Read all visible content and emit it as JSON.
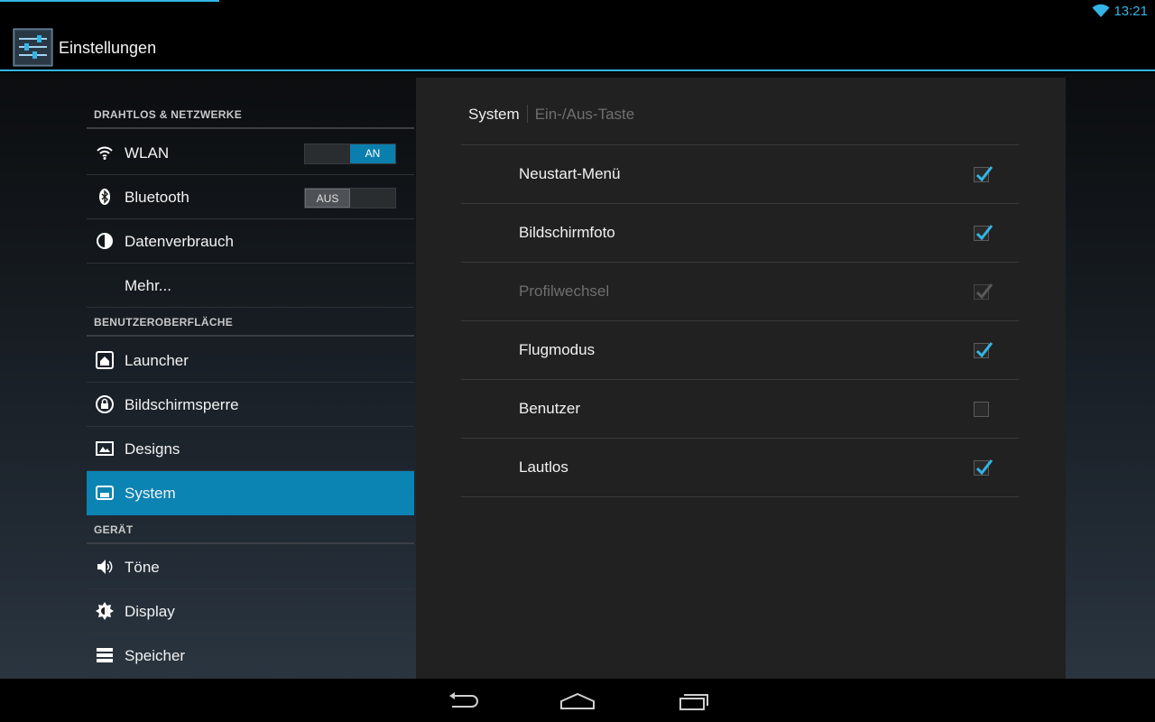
{
  "status": {
    "time": "13:21",
    "wifi_icon": "wifi-icon"
  },
  "app": {
    "title": "Einstellungen",
    "icon": "settings-sliders-icon"
  },
  "sidebar": {
    "sections": [
      {
        "header": "DRAHTLOS & NETZWERKE"
      },
      {
        "header": "BENUTZEROBERFLÄCHE"
      },
      {
        "header": "GERÄT"
      }
    ],
    "items": [
      {
        "label": "WLAN",
        "icon": "wifi-icon",
        "toggle": "AN",
        "state": "on"
      },
      {
        "label": "Bluetooth",
        "icon": "bluetooth-icon",
        "toggle": "AUS",
        "state": "off"
      },
      {
        "label": "Datenverbrauch",
        "icon": "data-usage-icon"
      },
      {
        "label": "Mehr..."
      },
      {
        "label": "Launcher",
        "icon": "launcher-icon"
      },
      {
        "label": "Bildschirmsperre",
        "icon": "lock-icon"
      },
      {
        "label": "Designs",
        "icon": "themes-icon"
      },
      {
        "label": "System",
        "icon": "system-icon",
        "selected": true
      },
      {
        "label": "Töne",
        "icon": "speaker-icon"
      },
      {
        "label": "Display",
        "icon": "brightness-icon"
      },
      {
        "label": "Speicher",
        "icon": "storage-icon"
      }
    ]
  },
  "detail": {
    "breadcrumb": {
      "current": "System",
      "next": "Ein-/Aus-Taste"
    },
    "items": [
      {
        "label": "Neustart-Menü",
        "checked": true,
        "enabled": true
      },
      {
        "label": "Bildschirmfoto",
        "checked": true,
        "enabled": true
      },
      {
        "label": "Profilwechsel",
        "checked": true,
        "enabled": false
      },
      {
        "label": "Flugmodus",
        "checked": true,
        "enabled": true
      },
      {
        "label": "Benutzer",
        "checked": false,
        "enabled": true
      },
      {
        "label": "Lautlos",
        "checked": true,
        "enabled": true
      }
    ]
  },
  "navbar": {
    "buttons": [
      "back-icon",
      "home-icon",
      "recents-icon"
    ]
  },
  "colors": {
    "accent": "#33b5e5",
    "selected": "#0b83b3"
  }
}
